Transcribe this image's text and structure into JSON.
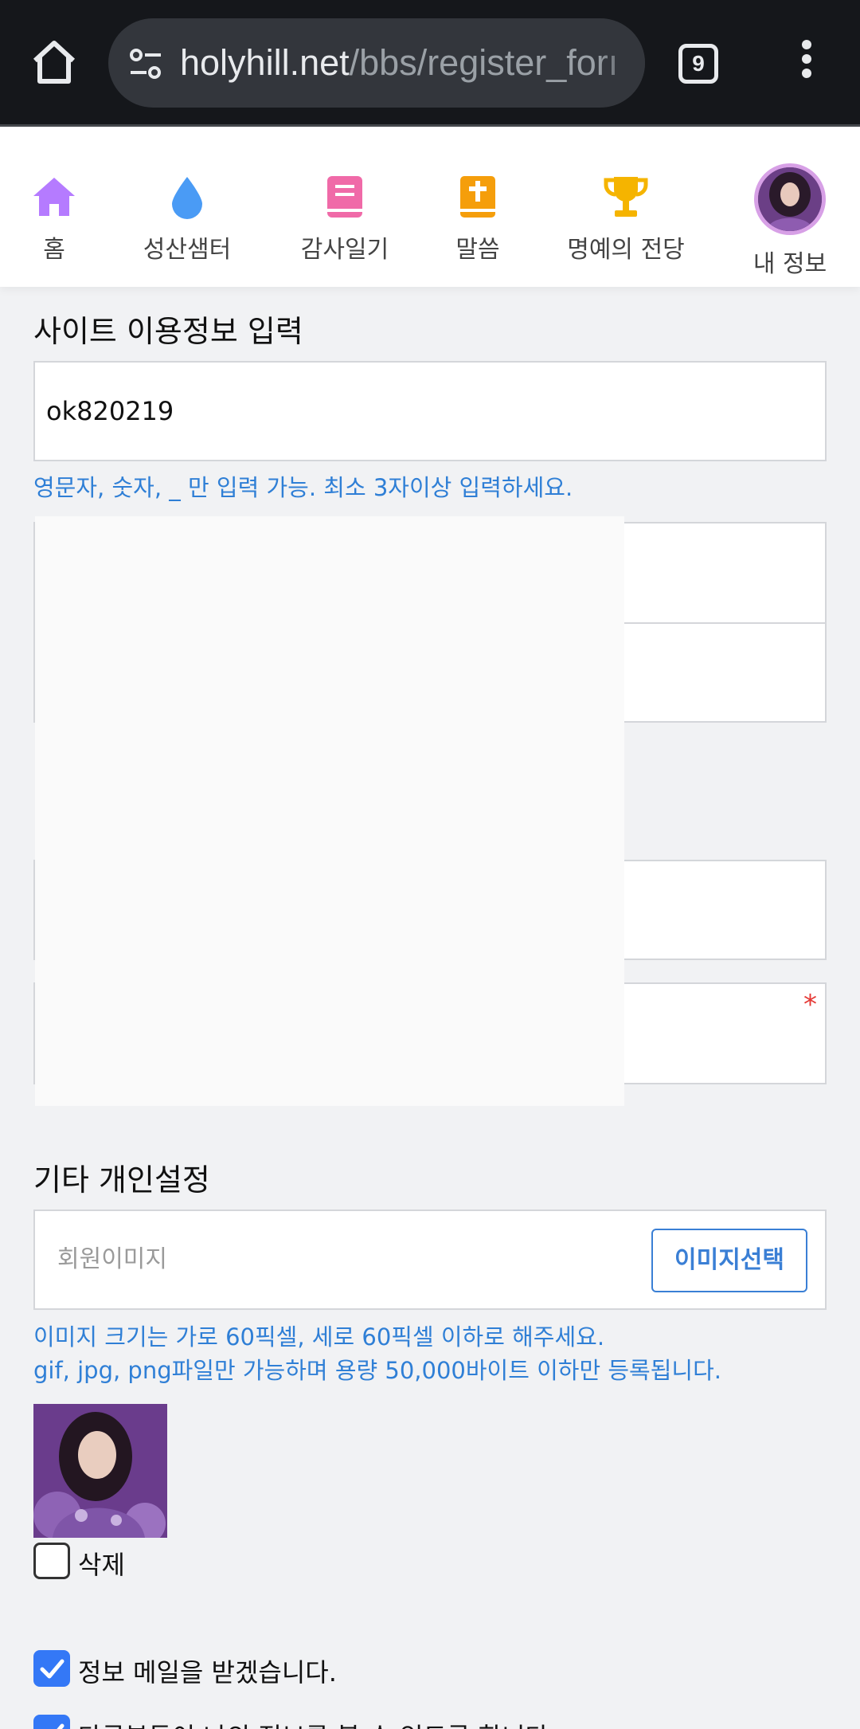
{
  "browser": {
    "url_host": "holyhill.net",
    "url_path": "/bbs/register_forı",
    "tab_count": "9",
    "icons": {
      "home": "home-icon",
      "site_settings": "tune-icon",
      "menu": "more-vert-icon"
    }
  },
  "nav": {
    "items": [
      {
        "label": "홈",
        "icon": "house-icon",
        "color": "#b57bff"
      },
      {
        "label": "성산샘터",
        "icon": "water-drop-icon",
        "color": "#4a9bf5"
      },
      {
        "label": "감사일기",
        "icon": "book-icon",
        "color": "#f06aa8"
      },
      {
        "label": "말씀",
        "icon": "bible-icon",
        "color": "#f59e0b"
      },
      {
        "label": "명예의 전당",
        "icon": "trophy-icon",
        "color": "#f5b400"
      },
      {
        "label": "내 정보",
        "icon": "avatar"
      }
    ]
  },
  "site_info": {
    "title": "사이트 이용정보 입력",
    "user_id": "ok820219",
    "id_hint": "영문자, 숫자, _ 만 입력 가능. 최소 3자이상 입력하세요.",
    "required_mark": "*"
  },
  "personal": {
    "title": "기타 개인설정",
    "image_placeholder": "회원이미지",
    "image_button": "이미지선택",
    "image_hint_1": "이미지 크기는 가로 60픽셀, 세로 60픽셀 이하로 해주세요.",
    "image_hint_2": "gif, jpg, png파일만 가능하며 용량 50,000바이트 이하만 등록됩니다.",
    "delete_label": "삭제",
    "delete_checked": false,
    "mail_label": "정보 메일을 받겠습니다.",
    "mail_checked": true,
    "next_label": "다른분들이 나의 정보를 볼 수 있도록 합니다.",
    "next_checked": true
  },
  "colors": {
    "accent": "#2f7fd6",
    "checkbox": "#3478f6",
    "required": "#e53935"
  }
}
